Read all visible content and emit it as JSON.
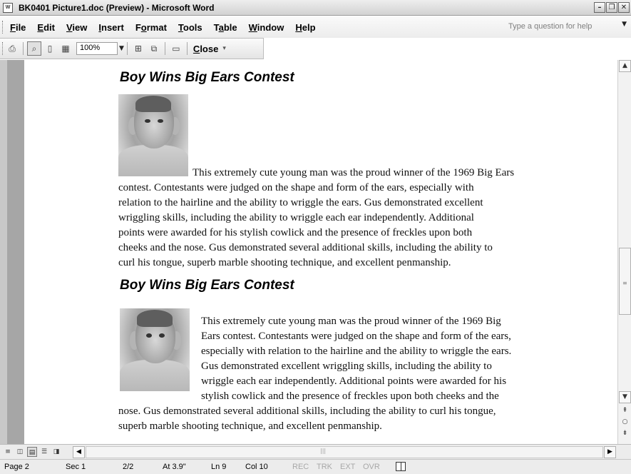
{
  "window": {
    "title": "BK0401 Picture1.doc (Preview) - Microsoft Word",
    "app_icon_text": "W",
    "controls": [
      "minimize",
      "restore",
      "close"
    ]
  },
  "menu": {
    "items": [
      {
        "pre": "",
        "key": "F",
        "post": "ile"
      },
      {
        "pre": "",
        "key": "E",
        "post": "dit"
      },
      {
        "pre": "",
        "key": "V",
        "post": "iew"
      },
      {
        "pre": "",
        "key": "I",
        "post": "nsert"
      },
      {
        "pre": "F",
        "key": "o",
        "post": "rmat"
      },
      {
        "pre": "",
        "key": "T",
        "post": "ools"
      },
      {
        "pre": "T",
        "key": "a",
        "post": "ble"
      },
      {
        "pre": "",
        "key": "W",
        "post": "indow"
      },
      {
        "pre": "",
        "key": "H",
        "post": "elp"
      }
    ],
    "ask_placeholder": "Type a question for help"
  },
  "toolbar": {
    "zoom": "100%",
    "close_pre": "",
    "close_key": "C",
    "close_post": "lose"
  },
  "document": {
    "heading1": "Boy Wins Big Ears Contest",
    "para1": [
      "This extremely cute young man was the proud winner of the 1969 Big Ears",
      "contest. Contestants were judged on the shape and form of the ears, especially with",
      "relation to the hairline and the ability to wriggle the ears. Gus demonstrated excellent",
      "wriggling skills, including the ability to wriggle each ear independently. Additional",
      "points were awarded for his stylish cowlick and the presence of freckles upon both",
      "cheeks and the nose. Gus demonstrated several additional skills, including the ability to",
      "curl his tongue, superb marble shooting technique, and excellent penmanship."
    ],
    "heading2": "Boy Wins Big Ears Contest",
    "para2": [
      "This extremely cute young man was the proud winner of the 1969 Big",
      "Ears contest. Contestants were judged on the shape and form of the ears,",
      "especially with relation to the hairline and the ability to wriggle the ears.",
      "Gus demonstrated excellent wriggling skills, including the ability to",
      "wriggle each ear independently. Additional points were awarded for his",
      "stylish cowlick and the presence of freckles upon both cheeks and the",
      "nose. Gus demonstrated several additional skills, including the ability to curl his tongue,",
      "superb marble shooting technique, and excellent penmanship."
    ]
  },
  "status": {
    "page": "Page 2",
    "sec": "Sec 1",
    "pages": "2/2",
    "at": "At 3.9\"",
    "ln": "Ln 9",
    "col": "Col 10",
    "rec": "REC",
    "trk": "TRK",
    "ext": "EXT",
    "ovr": "OVR"
  }
}
